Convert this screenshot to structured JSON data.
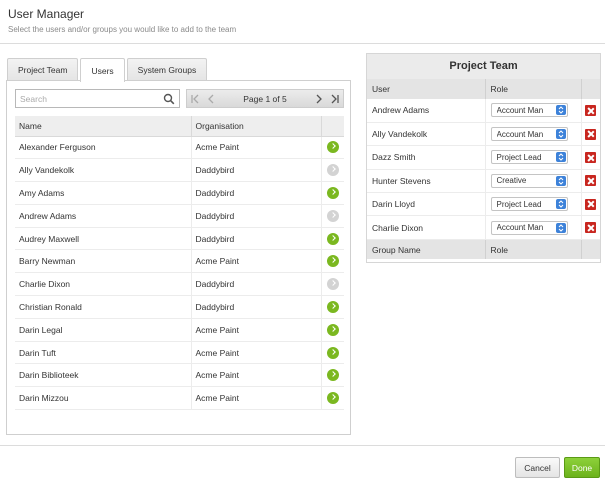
{
  "header": {
    "title": "User Manager",
    "subtitle": "Select the users and/or groups you would like to add to the team"
  },
  "tabs": [
    {
      "label": "Project Team",
      "active": false
    },
    {
      "label": "Users",
      "active": true
    },
    {
      "label": "System Groups",
      "active": false
    }
  ],
  "search": {
    "placeholder": "Search",
    "value": ""
  },
  "pager": {
    "info": "Page 1 of 5"
  },
  "users_table": {
    "columns": [
      "Name",
      "Organisation"
    ],
    "rows": [
      {
        "name": "Alexander Ferguson",
        "org": "Acme Paint",
        "added": false
      },
      {
        "name": "Ally Vandekolk",
        "org": "Daddybird",
        "added": true
      },
      {
        "name": "Amy Adams",
        "org": "Daddybird",
        "added": false
      },
      {
        "name": "Andrew Adams",
        "org": "Daddybird",
        "added": true
      },
      {
        "name": "Audrey Maxwell",
        "org": "Daddybird",
        "added": false
      },
      {
        "name": "Barry Newman",
        "org": "Acme Paint",
        "added": false
      },
      {
        "name": "Charlie Dixon",
        "org": "Daddybird",
        "added": true
      },
      {
        "name": "Christian Ronald",
        "org": "Daddybird",
        "added": false
      },
      {
        "name": "Darin Legal",
        "org": "Acme Paint",
        "added": false
      },
      {
        "name": "Darin Tuft",
        "org": "Acme Paint",
        "added": false
      },
      {
        "name": "Darin Biblioteek",
        "org": "Acme Paint",
        "added": false
      },
      {
        "name": "Darin Mizzou",
        "org": "Acme Paint",
        "added": false
      }
    ]
  },
  "project_team": {
    "title": "Project Team",
    "columns": [
      "User",
      "Role"
    ],
    "rows": [
      {
        "user": "Andrew Adams",
        "role": "Account Man"
      },
      {
        "user": "Ally Vandekolk",
        "role": "Account Man"
      },
      {
        "user": "Dazz Smith",
        "role": "Project Lead"
      },
      {
        "user": "Hunter Stevens",
        "role": "Creative"
      },
      {
        "user": "Darin Lloyd",
        "role": "Project Lead"
      },
      {
        "user": "Charlie Dixon",
        "role": "Account Man"
      }
    ],
    "group_columns": [
      "Group Name",
      "Role"
    ]
  },
  "footer": {
    "cancel_label": "Cancel",
    "done_label": "Done"
  },
  "colors": {
    "accent_green": "#7bb820",
    "select_blue": "#3d82d9",
    "delete_red": "#c8261f",
    "inactive_grey": "#d3d3d3"
  }
}
